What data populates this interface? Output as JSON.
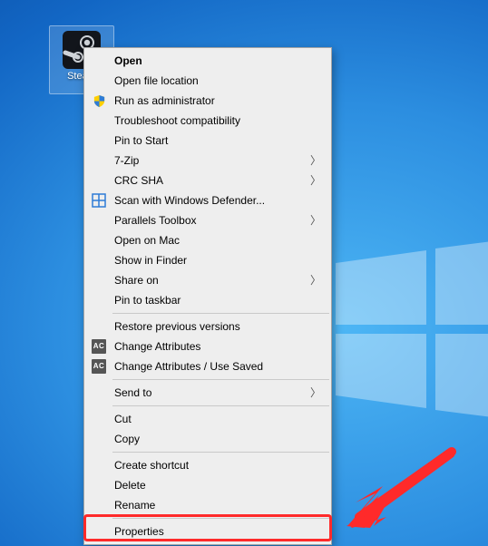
{
  "desktop_icon": {
    "label": "Steam"
  },
  "menu": {
    "open": "Open",
    "open_file_location": "Open file location",
    "run_as_admin": "Run as administrator",
    "troubleshoot": "Troubleshoot compatibility",
    "pin_start": "Pin to Start",
    "seven_zip": "7-Zip",
    "crc_sha": "CRC SHA",
    "defender": "Scan with Windows Defender...",
    "parallels": "Parallels Toolbox",
    "open_mac": "Open on Mac",
    "show_finder": "Show in Finder",
    "share_on": "Share on",
    "pin_taskbar": "Pin to taskbar",
    "restore_prev": "Restore previous versions",
    "change_attr": "Change Attributes",
    "change_attr_saved": "Change Attributes / Use Saved",
    "send_to": "Send to",
    "cut": "Cut",
    "copy": "Copy",
    "create_shortcut": "Create shortcut",
    "delete": "Delete",
    "rename": "Rename",
    "properties": "Properties"
  },
  "icons": {
    "ac": "AC"
  },
  "colors": {
    "arrow": "#ff2a2a"
  }
}
